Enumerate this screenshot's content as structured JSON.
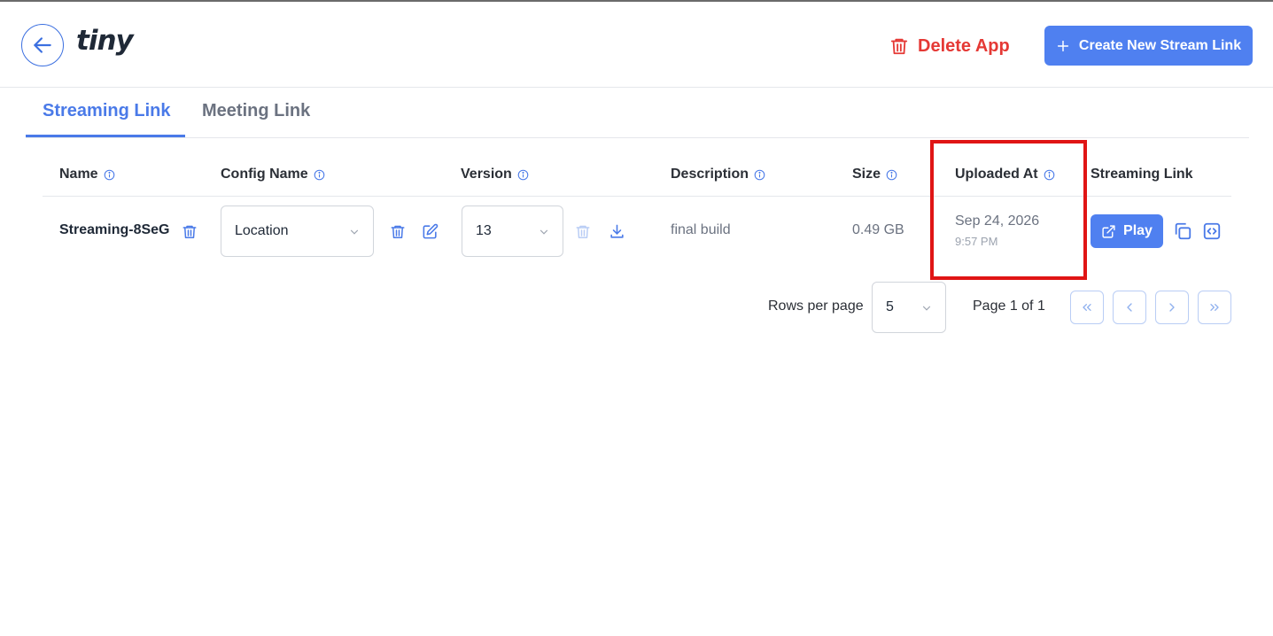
{
  "header": {
    "logo": "tiny",
    "delete_label": "Delete App",
    "create_label": "Create New Stream Link"
  },
  "tabs": [
    {
      "label": "Streaming Link",
      "active": true
    },
    {
      "label": "Meeting Link",
      "active": false
    }
  ],
  "table": {
    "columns": [
      "Name",
      "Config Name",
      "Version",
      "Description",
      "Size",
      "Uploaded At",
      "Streaming Link"
    ],
    "rows": [
      {
        "name": "Streaming-8SeG",
        "config": "Location",
        "version": "13",
        "description": "final build",
        "size": "0.49 GB",
        "uploaded_date": "Sep 24, 2026",
        "uploaded_time": "9:57 PM",
        "play_label": "Play"
      }
    ]
  },
  "pagination": {
    "rows_label": "Rows per page",
    "rows_value": "5",
    "page_info": "Page 1 of 1"
  },
  "colors": {
    "primary": "#4f80f0",
    "danger": "#e53935",
    "highlight": "#e01515"
  }
}
